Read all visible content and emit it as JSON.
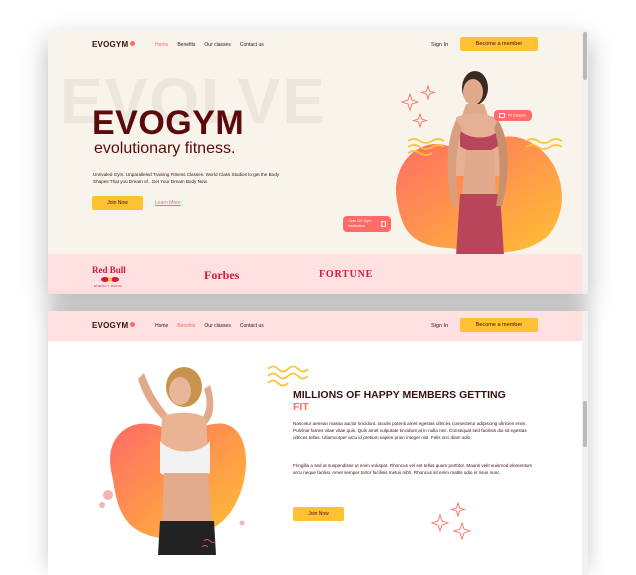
{
  "nav": {
    "logo": "EVOGYM",
    "links": [
      "Home",
      "Benefits",
      "Our classes",
      "Contact us"
    ],
    "sign_in": "Sign In",
    "cta": "Become a member"
  },
  "hero": {
    "bg_word": "EVOLVE",
    "title": "EVOGYM",
    "subtitle": "evolutionary fitness.",
    "description": "Unrivaled Gym. Unparalleled Training Fitness Classes. World Class Studios to get the Body Shapes That you Dream of.. Get Your Dream Body Now.",
    "join_button": "Join Now",
    "learn_more": "Learn More",
    "badge_top": "Fit Classes",
    "badge_bottom": "Over 20+ Gym Instructors"
  },
  "brands": {
    "redbull": "Red Bull",
    "redbull_sub": "ENERGY DRINK",
    "forbes": "Forbes",
    "fortune": "FORTUNE"
  },
  "benefits": {
    "title_main": "MILLIONS OF HAPPY MEMBERS GETTING",
    "title_highlight": "FIT",
    "paragraph1": "Nascetur aenean massa auctor tincidunt. Iaculis potenti amet egestas ultrices consectetur adipiscing ultricies enim. Pulvinar fames vitae vitae quis. Quis amet vulputate tincidunt at in nulla nec. Consequat sed facilisis dui sit egestas ultrices tellus. Ullamcorper arcu id pretium sapien proin integer nisl. Felis orci diam odio.",
    "paragraph2": "Fringilla a sed at suspendisse ut enim volutpat. Rhoncus vel est tellus quam porttitor. Mauris velit euismod elementum arcu neque facilisi. Amet semper tortor facilisis metus nibh. Rhoncus sit enim mattis odio in risus nunc.",
    "join_button": "Join Now"
  },
  "colors": {
    "primary": "#ffc132",
    "accent": "#ff6b66",
    "dark_text": "#3a0f0f",
    "brand_red": "#d6173e",
    "nav_bg_scrolled": "#ffe1e1",
    "hero_bg": "#f8f4eb"
  }
}
